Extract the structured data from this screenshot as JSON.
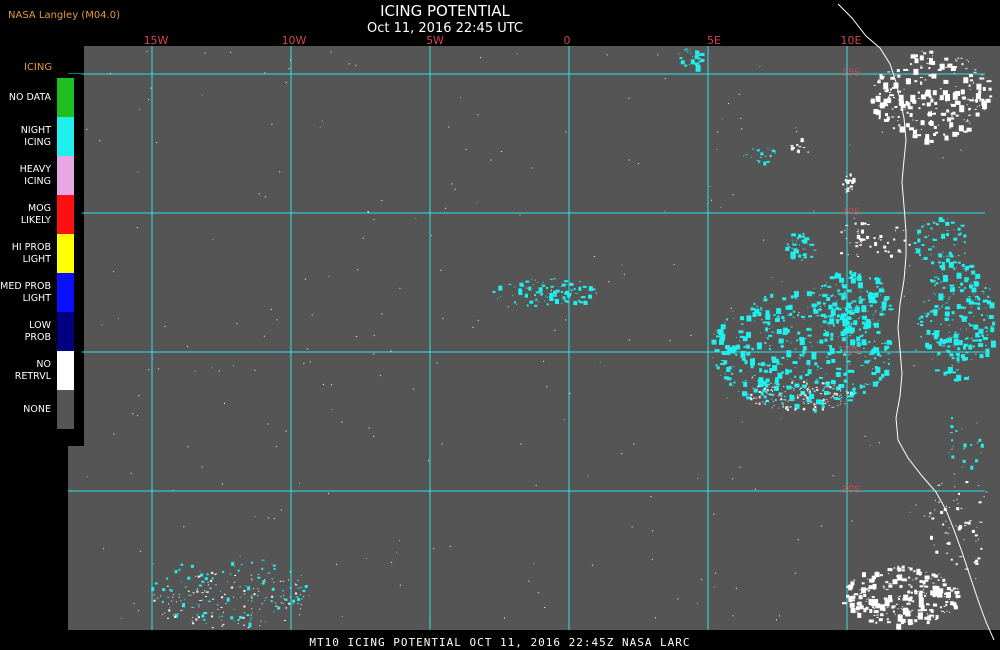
{
  "header": {
    "credit": "NASA Langley (M04.0)",
    "title": "ICING POTENTIAL",
    "datetime": "Oct 11, 2016 22:45 UTC"
  },
  "map": {
    "background_color": "#555555",
    "grid_color": "#2fe3e8",
    "label_color": "#d2464b",
    "longitude_labels": [
      "15W",
      "10W",
      "5W",
      "0",
      "5E",
      "10E"
    ],
    "latitude_labels": [
      "15S",
      "20S",
      "25S",
      "30S"
    ]
  },
  "legend": {
    "title": "ICING",
    "items": [
      {
        "label": "NO DATA",
        "color": "#1fbf1f"
      },
      {
        "label": "NIGHT\nICING",
        "color": "#1ff0ee"
      },
      {
        "label": "HEAVY\nICING",
        "color": "#e8a6e4"
      },
      {
        "label": "MOG\nLIKELY",
        "color": "#ff1010"
      },
      {
        "label": "HI PROB\nLIGHT",
        "color": "#ffff00"
      },
      {
        "label": "MED PROB\nLIGHT",
        "color": "#0a10ff"
      },
      {
        "label": "LOW\nPROB",
        "color": "#000080"
      },
      {
        "label": "NO\nRETRVL",
        "color": "#ffffff"
      },
      {
        "label": "NONE",
        "color": "#555555"
      }
    ]
  },
  "footer": {
    "text": "MT10   ICING POTENTIAL   OCT 11, 2016 22:45Z   NASA LARC"
  }
}
